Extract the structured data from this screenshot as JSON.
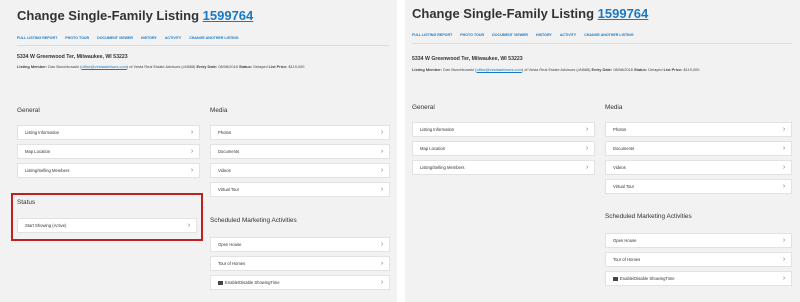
{
  "header": {
    "title": "Change Single-Family Listing",
    "listing_number": "1599764",
    "nav": [
      "FULL LISTING REPORT",
      "PHOTO TOUR",
      "DOCUMENT VIEWER",
      "HISTORY",
      "ACTIVITY",
      "CHANGE ANOTHER LISTING"
    ]
  },
  "listing": {
    "address": "5334 W Greenwood Ter, Milwaukee, WI 53223",
    "member_label": "Listing Member:",
    "member_name": "Dan Bunchkowski (",
    "member_email": "office@vestaadvisors.com",
    "member_suffix": ") of Vesta Real Estate Advisors (oN588)",
    "entry_label": "Entry Date:",
    "entry_value": "08/08/2018",
    "status_label": "Status:",
    "status_value": "Delayed",
    "price_label": "List Price:",
    "price_value": "$119,000"
  },
  "general": {
    "heading": "General",
    "items": [
      "Listing Information",
      "Map Location",
      "Listing/Selling Members"
    ]
  },
  "media": {
    "heading": "Media",
    "items": [
      "Photos",
      "Documents",
      "Videos",
      "Virtual Tour"
    ]
  },
  "status": {
    "heading": "Status",
    "items": [
      "Start Showing (Active)"
    ]
  },
  "scheduled": {
    "heading": "Scheduled Marketing Activities",
    "items": [
      "Open House",
      "Tour of Homes",
      "Enable/Disable ShowingTime"
    ]
  },
  "chevron": "›",
  "highlight_color": "#c0201e"
}
